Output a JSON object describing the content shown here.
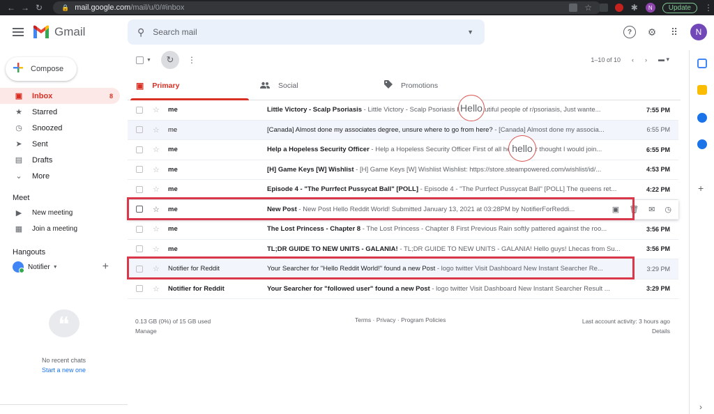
{
  "browser": {
    "url_host": "mail.google.com",
    "url_path": "/mail/u/0/#inbox",
    "update_label": "Update",
    "profile_initial": "N"
  },
  "header": {
    "app_name": "Gmail",
    "search_placeholder": "Search mail",
    "avatar_initial": "N"
  },
  "sidebar": {
    "compose_label": "Compose",
    "items": [
      {
        "label": "Inbox",
        "icon": "inbox-icon",
        "glyph": "▣",
        "count": "8",
        "active": true
      },
      {
        "label": "Starred",
        "icon": "star-icon",
        "glyph": "★"
      },
      {
        "label": "Snoozed",
        "icon": "clock-icon",
        "glyph": "◷"
      },
      {
        "label": "Sent",
        "icon": "send-icon",
        "glyph": "➤"
      },
      {
        "label": "Drafts",
        "icon": "draft-icon",
        "glyph": "▤"
      },
      {
        "label": "More",
        "icon": "chevron-down-icon",
        "glyph": "⌄"
      }
    ],
    "meet_title": "Meet",
    "meet_items": [
      {
        "label": "New meeting",
        "icon": "video-icon",
        "glyph": "▶"
      },
      {
        "label": "Join a meeting",
        "icon": "keyboard-icon",
        "glyph": "▦"
      }
    ],
    "hangouts_title": "Hangouts",
    "hangouts_user": "Notifier",
    "no_chats": "No recent chats",
    "start_chat": "Start a new one"
  },
  "toolbar": {
    "pagination": "1–10 of 10"
  },
  "tabs": [
    {
      "label": "Primary",
      "icon": "inbox-tab-icon",
      "glyph": "▣",
      "active": true
    },
    {
      "label": "Social",
      "icon": "people-icon",
      "glyph": "👥"
    },
    {
      "label": "Promotions",
      "icon": "tag-icon",
      "glyph": "◆"
    }
  ],
  "emails": [
    {
      "sender": "me",
      "subject": "Little Victory - Scalp Psoriasis",
      "snippet": " - Little Victory - Scalp Psoriasis Hello beautiful people of r/psoriasis, Just wante...",
      "time": "7:55 PM",
      "unread": true
    },
    {
      "sender": "me",
      "subject": "[Canada] Almost done my associates degree, unsure where to go from here?",
      "snippet": " - [Canada] Almost done my associa...",
      "time": "6:55 PM",
      "unread": false
    },
    {
      "sender": "me",
      "subject": "Help a Hopeless Security Officer",
      "snippet": " - Help a Hopeless Security Officer First of all hello, never thought I would join...",
      "time": "6:55 PM",
      "unread": true
    },
    {
      "sender": "me",
      "subject": "[H] Game Keys [W] Wishlist",
      "snippet": " - [H] Game Keys [W] Wishlist Wishlist: https://store.steampowered.com/wishlist/id/...",
      "time": "4:53 PM",
      "unread": true
    },
    {
      "sender": "me",
      "subject": "Episode 4 - \"The Purrfect Pussycat Ball\" [POLL]",
      "snippet": " - Episode 4 - \"The Purrfect Pussycat Ball\" [POLL] The queens ret...",
      "time": "4:22 PM",
      "unread": true
    },
    {
      "sender": "me",
      "subject": "New Post",
      "snippet": " - New Post Hello Reddit World! Submitted January 13, 2021 at 03:28PM by NotifierForReddi...",
      "time": "",
      "unread": true,
      "hover": true
    },
    {
      "sender": "me",
      "subject": "The Lost Princess - Chapter 8",
      "snippet": " - The Lost Princess - Chapter 8 First Previous Rain softly pattered against the roo...",
      "time": "3:56 PM",
      "unread": true
    },
    {
      "sender": "me",
      "subject": "TL;DR GUIDE TO NEW UNITS - GALANIA!",
      "snippet": " - TL;DR GUIDE TO NEW UNITS - GALANIA! Hello guys! Lhecas from Su...",
      "time": "3:56 PM",
      "unread": true
    },
    {
      "sender": "Notifier for Reddit",
      "subject": "Your Searcher for \"Hello Reddit World!\" found a new Post",
      "snippet": " - logo twitter Visit Dashboard New Instant Searcher Re...",
      "time": "3:29 PM",
      "unread": false
    },
    {
      "sender": "Notifier for Reddit",
      "subject": "Your Searcher for \"followed user\" found a new Post",
      "snippet": " - logo twitter Visit Dashboard New Instant Searcher Result ...",
      "time": "3:29 PM",
      "unread": true
    }
  ],
  "annotations": {
    "circle1": "Hello",
    "circle2": "hello"
  },
  "footer": {
    "storage": "0.13 GB (0%) of 15 GB used",
    "manage": "Manage",
    "links": "Terms · Privacy · Program Policies",
    "activity": "Last account activity: 3 hours ago",
    "details": "Details"
  },
  "colors": {
    "accent_red": "#d93025",
    "highlight_box": "#d9384a",
    "read_row_bg": "#f2f6fc"
  }
}
